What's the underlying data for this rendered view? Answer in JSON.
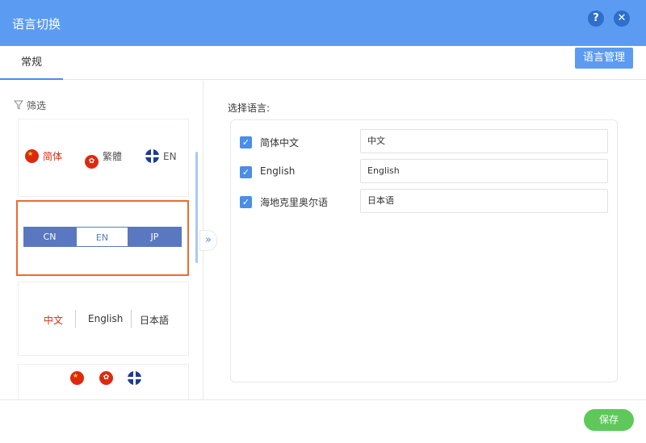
{
  "header": {
    "title": "语言切换",
    "help_icon": "?",
    "close_icon": "✕",
    "accent": "#5b9cf2"
  },
  "tabs": [
    {
      "label": "常规",
      "active": true
    }
  ],
  "toolbar": {
    "lang_manage_label": "语言管理"
  },
  "filter": {
    "label": "筛选"
  },
  "styles": {
    "flags": [
      "简体",
      "繁體",
      "EN"
    ],
    "segmented": {
      "items": [
        "CN",
        "EN",
        "JP"
      ],
      "selected": "EN"
    },
    "text": [
      "中文",
      "English",
      "日本語"
    ]
  },
  "right": {
    "label": "选择语言:",
    "languages": [
      {
        "name": "简体中文",
        "checked": true,
        "value": "中文"
      },
      {
        "name": "English",
        "checked": true,
        "value": "English"
      },
      {
        "name": "海地克里奥尔语",
        "checked": true,
        "value": "日本语"
      }
    ]
  },
  "toggle": {
    "icon": "»"
  },
  "footer": {
    "save_label": "保存",
    "save_color": "#5ec95a"
  },
  "colors": {
    "selected_border": "#ee6b2d",
    "segment": "#5a78c1",
    "cn_text": "#de2910"
  }
}
